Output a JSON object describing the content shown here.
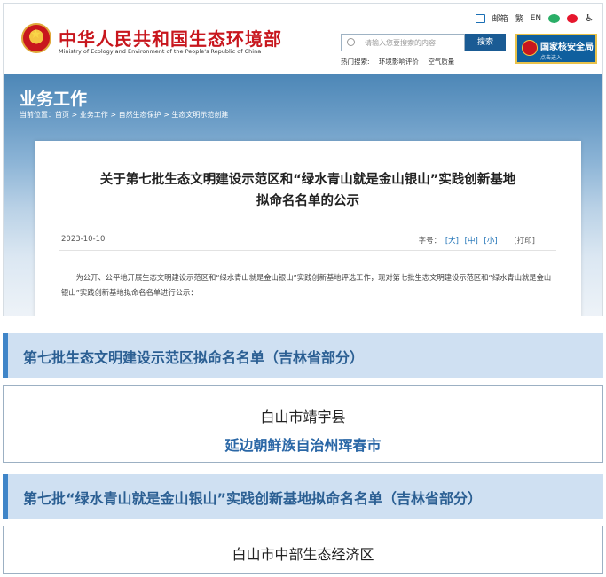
{
  "header": {
    "title": "中华人民共和国生态环境部",
    "subtitle": "Ministry of Ecology and Environment of the People's Republic of China",
    "links": {
      "mail": "邮箱",
      "traditional": "繁",
      "english": "EN"
    },
    "search": {
      "placeholder": "请输入您要搜索的内容",
      "button": "搜索"
    },
    "hot": {
      "label": "热门搜索:",
      "items": [
        "环境影响评价",
        "空气质量"
      ]
    },
    "nnsa": {
      "name": "国家核安全局",
      "action": "点击进入"
    }
  },
  "banner": {
    "title": "业务工作",
    "breadcrumb": "当前位置：首页 > 业务工作 > 自然生态保护 > 生态文明示范创建"
  },
  "article": {
    "title_line1": "关于第七批生态文明建设示范区和“绿水青山就是金山银山”实践创新基地",
    "title_line2": "拟命名名单的公示",
    "date": "2023-10-10",
    "font_size_label": "字号：",
    "sizes": [
      "[大]",
      "[中]",
      "[小]"
    ],
    "print": "[打印]",
    "body": "为公开、公平地开展生态文明建设示范区和“绿水青山就是金山银山”实践创新基地评选工作，现对第七批生态文明建设示范区和“绿水青山就是金山银山”实践创新基地拟命名名单进行公示："
  },
  "sections": [
    {
      "title": "第七批生态文明建设示范区拟命名名单（吉林省部分）",
      "items": [
        "白山市靖宇县",
        "延边朝鲜族自治州珲春市"
      ]
    },
    {
      "title": "第七批“绿水青山就是金山银山”实践创新基地拟命名名单（吉林省部分）",
      "items": [
        "白山市中部生态经济区"
      ]
    }
  ],
  "colors": {
    "brand_red": "#c8161d",
    "nav_blue": "#1a5b94",
    "section_bg": "#cfe0f2",
    "section_text": "#2b5f93",
    "highlight_blue": "#2a67a6"
  }
}
